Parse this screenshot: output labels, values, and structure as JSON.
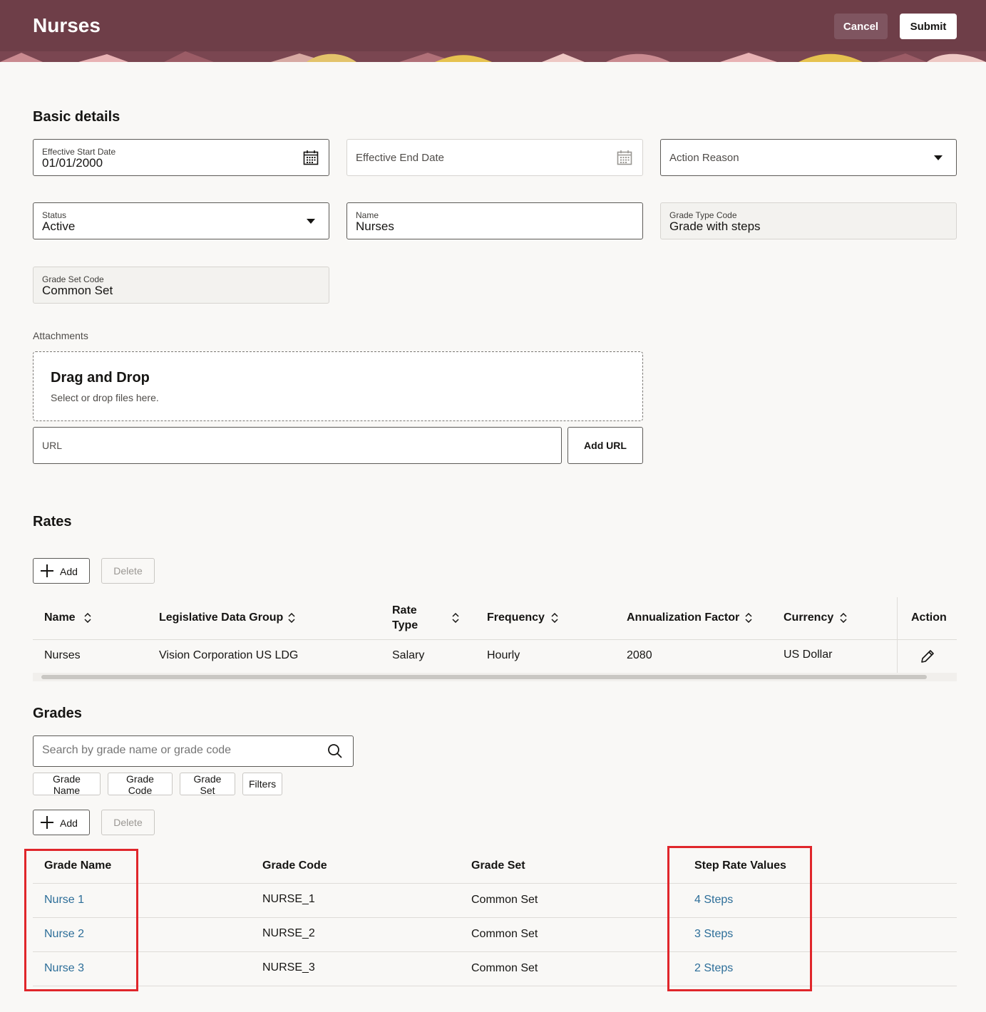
{
  "header": {
    "title": "Nurses",
    "cancel_label": "Cancel",
    "submit_label": "Submit"
  },
  "basic_details": {
    "title": "Basic details",
    "effective_start_date": {
      "label": "Effective Start Date",
      "value": "01/01/2000"
    },
    "effective_end_date": {
      "placeholder": "Effective End Date"
    },
    "action_reason": {
      "placeholder": "Action Reason"
    },
    "status": {
      "label": "Status",
      "value": "Active"
    },
    "name": {
      "label": "Name",
      "value": "Nurses"
    },
    "grade_type_code": {
      "label": "Grade Type Code",
      "value": "Grade with steps"
    },
    "grade_set_code": {
      "label": "Grade Set Code",
      "value": "Common Set"
    }
  },
  "attachments": {
    "label": "Attachments",
    "drop_title": "Drag and Drop",
    "drop_subtitle": "Select or drop files here.",
    "url_placeholder": "URL",
    "add_url_label": "Add URL"
  },
  "rates": {
    "title": "Rates",
    "add_label": "Add",
    "delete_label": "Delete",
    "columns": [
      "Name",
      "Legislative Data Group",
      "Rate",
      "Type",
      "Frequency",
      "Annualization Factor",
      "Currency",
      "Action"
    ],
    "rows": [
      {
        "name": "Nurses",
        "ldg": "Vision Corporation US LDG",
        "rate_type": "Salary",
        "frequency": "Hourly",
        "annualization_factor": "2080",
        "currency": "US Dollar"
      }
    ]
  },
  "grades": {
    "title": "Grades",
    "search_placeholder": "Search by grade name or grade code",
    "chips": [
      "Grade Name",
      "Grade Code",
      "Grade Set",
      "Filters"
    ],
    "add_label": "Add",
    "delete_label": "Delete",
    "columns": [
      "Grade Name",
      "Grade Code",
      "Grade Set",
      "Step Rate Values"
    ],
    "rows": [
      {
        "grade_name": "Nurse 1",
        "grade_code": "NURSE_1",
        "grade_set": "Common Set",
        "steps": "4 Steps"
      },
      {
        "grade_name": "Nurse 2",
        "grade_code": "NURSE_2",
        "grade_set": "Common Set",
        "steps": "3 Steps"
      },
      {
        "grade_name": "Nurse 3",
        "grade_code": "NURSE_3",
        "grade_set": "Common Set",
        "steps": "2 Steps"
      }
    ]
  },
  "colors": {
    "header_bg": "#6e3e48",
    "link": "#2d6e99",
    "highlight": "#e0262b"
  }
}
